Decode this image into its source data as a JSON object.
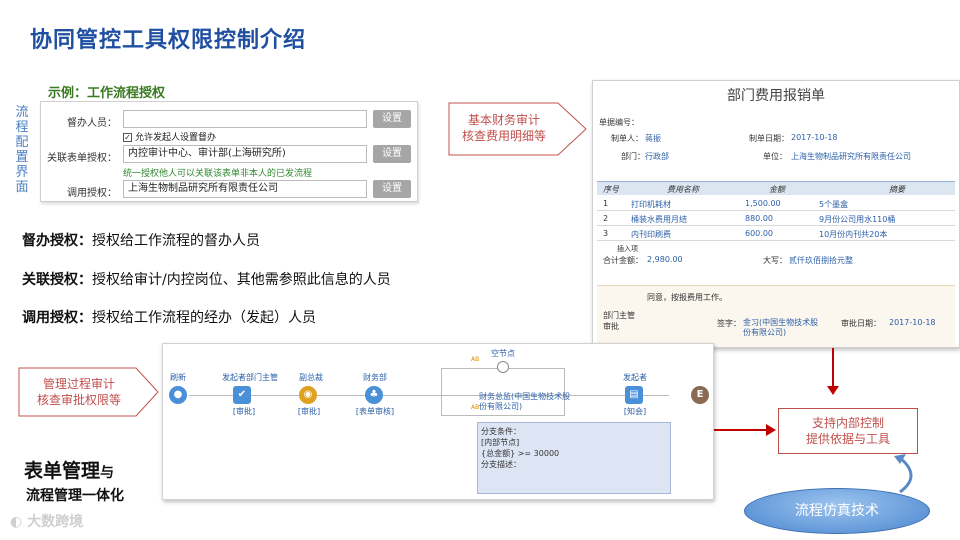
{
  "title": "协同管控工具权限控制介绍",
  "vertical_label": "流程配置界面",
  "example_title": "示例：工作流程授权",
  "config": {
    "rows": [
      {
        "label": "督办人员：",
        "value": "",
        "button": "设置"
      },
      {
        "label": "关联表单授权：",
        "value": "内控审计中心、审计部(上海研究所)",
        "button": "设置"
      },
      {
        "label": "调用授权：",
        "value": "上海生物制品研究所有限责任公司",
        "button": "设置"
      }
    ],
    "checkbox_label": "允许发起人设置督办",
    "checkbox_mark": "✓",
    "hint": "统一授权他人可以关联该表单非本人的已发流程"
  },
  "descriptions": [
    {
      "term": "督办授权：",
      "text": "授权给工作流程的督办人员"
    },
    {
      "term": "关联授权：",
      "text": "授权给审计/内控岗位、其他需参照此信息的人员"
    },
    {
      "term": "调用授权：",
      "text": "授权给工作流程的经办（发起）人员"
    }
  ],
  "callouts": {
    "finance": [
      "基本财务审计",
      "核查费用明细等"
    ],
    "process": [
      "管理过程审计",
      "核查审批权限等"
    ],
    "support": [
      "支持内部控制",
      "提供依据与工具"
    ]
  },
  "form": {
    "title": "部门费用报销单",
    "doc_no_label": "单据编号：",
    "creator_label": "制单人：",
    "creator": "蒋振",
    "date_label": "制单日期：",
    "date": "2017-10-18",
    "dept_label": "部门：",
    "dept": "行政部",
    "unit_label": "单位：",
    "unit": "上海生物制品研究所有限责任公司",
    "columns": [
      "序号",
      "费用名称",
      "金额",
      "摘要"
    ],
    "rows": [
      [
        "1",
        "打印机耗材",
        "1,500.00",
        "5个墨盒"
      ],
      [
        "2",
        "桶装水费用月结",
        "880.00",
        "9月份公司用水110桶"
      ],
      [
        "3",
        "内刊印刷费",
        "600.00",
        "10月份内刊共20本"
      ]
    ],
    "insert_label": "插入项",
    "total_label": "合计金额：",
    "total": "2,980.00",
    "upper_label": "大写：",
    "upper": "贰仟玖佰捌拾元整",
    "approval_label": "部门主管审批",
    "approval_text": "同意，按报费用工作。",
    "sign_label": "签字：",
    "signer": "金习(中国生物技术股份有限公司)",
    "approval_date_label": "审批日期：",
    "approval_date": "2017-10-18"
  },
  "flow": {
    "nodes": [
      {
        "label": "刷新",
        "sub": ""
      },
      {
        "label": "发起者部门主管",
        "sub": "[审批]"
      },
      {
        "label": "副总裁",
        "sub": "[审批]"
      },
      {
        "label": "财务部",
        "sub": "[表单审核]"
      },
      {
        "label": "发起者",
        "sub": "[知会]"
      }
    ],
    "empty_node": "空节点",
    "branch_node": "财务总监(中国生物技术股份有限公司)",
    "end_label": "E",
    "branch_conditions": [
      "分支条件：",
      "[内部节点]",
      "{总金额} >= 30000",
      "分支描述："
    ],
    "ab_tag": "AB"
  },
  "bottom": {
    "line1": "表单管理",
    "line1_small": "与",
    "line2": "流程管理一体化",
    "logo": "大数跨境"
  },
  "sim_label": "流程仿真技术",
  "colors": {
    "title": "#1f4fa0",
    "callout": "#c0504d",
    "arrow": "#c00000",
    "node": "#4a90d9"
  }
}
